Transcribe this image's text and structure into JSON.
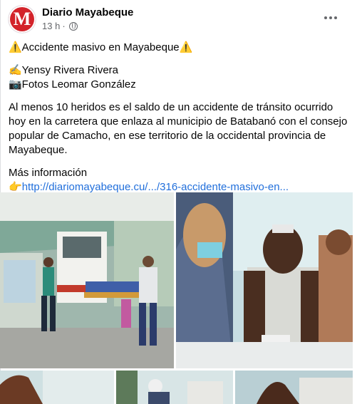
{
  "post": {
    "page_name": "Diario Mayabeque",
    "avatar_letter": "M",
    "timestamp": "13 h",
    "separator": "·",
    "privacy_icon": "globe-icon",
    "more_icon": "more-options-icon",
    "headline": "⚠️Accidente masivo en Mayabeque⚠️",
    "byline_author": "✍️Yensy Rivera Rivera",
    "byline_photos": "📷Fotos Leomar González",
    "body": "Al menos 10 heridos es el saldo de un accidente de tránsito ocurrido hoy en la carretera que enlaza al municipio de Batabanó con el consejo popular de Camacho, en ese territorio de la occidental provincia de Mayabeque.",
    "more_info_label": "Más información",
    "link_prefix": "👉",
    "link_text": "http://diariomayabeque.cu/.../316-accidente-masivo-en..."
  },
  "colors": {
    "brand_red": "#d3232a",
    "link_blue": "#216fdb",
    "secondary_text": "#65676b"
  }
}
